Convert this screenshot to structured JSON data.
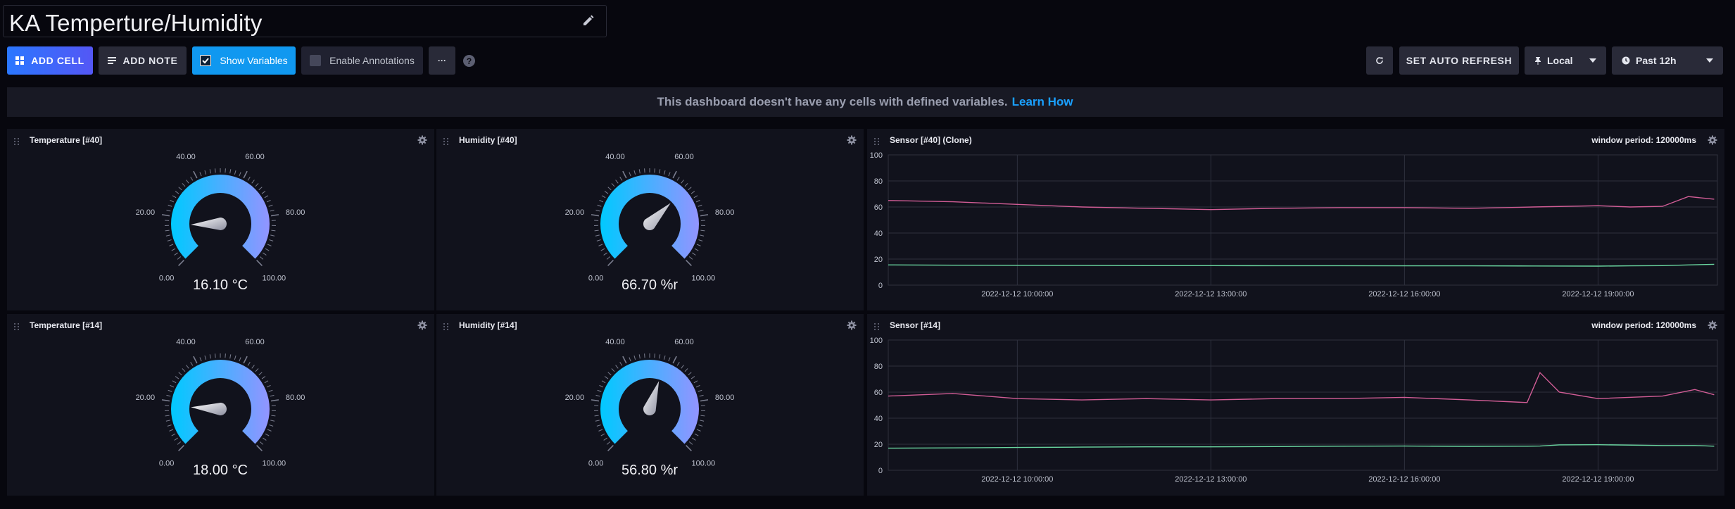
{
  "dashboard": {
    "title": "KA Temperture/Humidity"
  },
  "toolbar": {
    "add_cell": "ADD CELL",
    "add_note": "ADD NOTE",
    "show_variables": "Show Variables",
    "enable_annotations": "Enable Annotations",
    "more": "···",
    "help": "?",
    "auto_refresh": "SET AUTO REFRESH",
    "timezone": "Local",
    "time_range": "Past 12h"
  },
  "banner": {
    "text": "This dashboard doesn't have any cells with defined variables.",
    "link": "Learn How"
  },
  "colors": {
    "accent": "#1e7fff",
    "gauge_start": "#00c9ff",
    "gauge_end": "#9394ff",
    "line_humidity": "#d25d96",
    "line_temperature": "#6ad6a0"
  },
  "gauge_ticks": [
    "0.00",
    "20.00",
    "40.00",
    "60.00",
    "80.00",
    "100.00"
  ],
  "cells": {
    "temp40": {
      "title": "Temperature [#40]",
      "value": 16.1,
      "label": "16.10 °C"
    },
    "hum40": {
      "title": "Humidity [#40]",
      "value": 66.7,
      "label": "66.70 %r"
    },
    "temp14": {
      "title": "Temperature [#14]",
      "value": 18.0,
      "label": "18.00 °C"
    },
    "hum14": {
      "title": "Humidity [#14]",
      "value": 56.8,
      "label": "56.80 %r"
    },
    "sensor40": {
      "title": "Sensor [#40] (Clone)",
      "window": "window period: 120000ms"
    },
    "sensor14": {
      "title": "Sensor [#14]",
      "window": "window period: 120000ms"
    }
  },
  "chart_data": [
    {
      "type": "line",
      "title": "Sensor [#40] (Clone)",
      "ylim": [
        0,
        100
      ],
      "yticks": [
        "0",
        "20",
        "40",
        "60",
        "80",
        "100"
      ],
      "xticks": [
        "2022-12-12 10:00:00",
        "2022-12-12 13:00:00",
        "2022-12-12 16:00:00",
        "2022-12-12 19:00:00"
      ],
      "x_hours": [
        8,
        9,
        10,
        11,
        12,
        13,
        14,
        15,
        16,
        17,
        18,
        19,
        19.5,
        20,
        20.4,
        20.8
      ],
      "series": [
        {
          "values": [
            65,
            64,
            62,
            60,
            59,
            58,
            59,
            59.5,
            59.5,
            59,
            60,
            61,
            60,
            60.5,
            68,
            66
          ]
        },
        {
          "values": [
            15.5,
            15.3,
            15.2,
            15.1,
            15,
            15,
            14.9,
            14.9,
            14.8,
            14.8,
            14.7,
            14.6,
            14.8,
            15,
            15.5,
            16
          ]
        }
      ]
    },
    {
      "type": "line",
      "title": "Sensor [#14]",
      "ylim": [
        0,
        100
      ],
      "yticks": [
        "0",
        "20",
        "40",
        "60",
        "80",
        "100"
      ],
      "xticks": [
        "2022-12-12 10:00:00",
        "2022-12-12 13:00:00",
        "2022-12-12 16:00:00",
        "2022-12-12 19:00:00"
      ],
      "x_hours": [
        8,
        9,
        10,
        11,
        12,
        13,
        14,
        15,
        16,
        17,
        17.9,
        18.1,
        18.4,
        19,
        20,
        20.5,
        20.8
      ],
      "series": [
        {
          "values": [
            57,
            59,
            55,
            54,
            55,
            54,
            55,
            55,
            56,
            54,
            52,
            75,
            60,
            55,
            57,
            62,
            58
          ]
        },
        {
          "values": [
            17,
            17.2,
            17.5,
            17.8,
            18,
            18,
            18.2,
            18.5,
            18.6,
            18.4,
            18.5,
            18.6,
            19.5,
            19.6,
            19,
            19,
            18.5
          ]
        }
      ]
    }
  ]
}
